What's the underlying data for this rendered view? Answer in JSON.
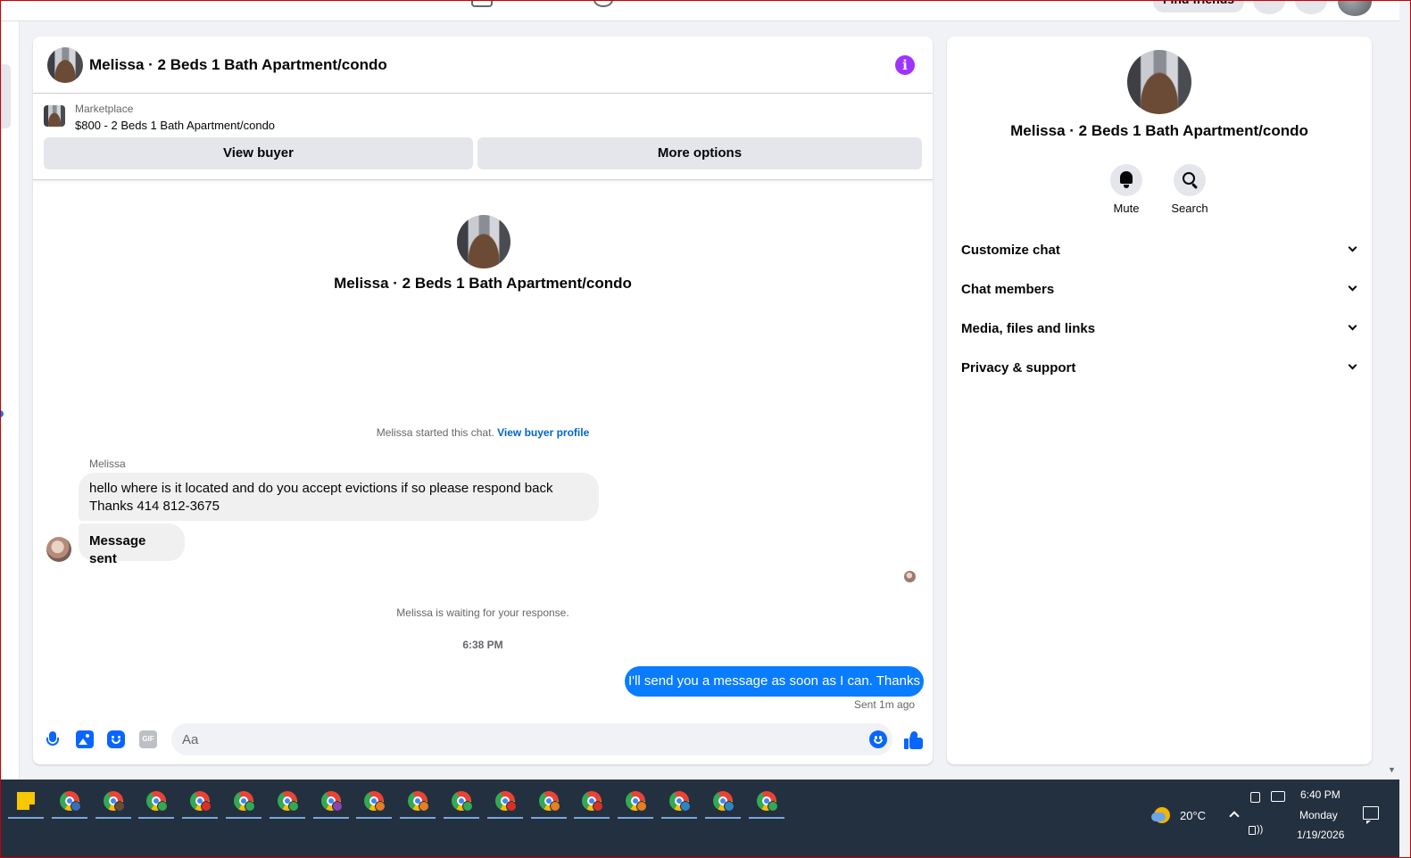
{
  "chat": {
    "title": "Melissa · 2 Beds 1 Bath Apartment/condo",
    "listing": {
      "source_label": "Marketplace",
      "price_title": "$800 - 2 Beds 1 Bath Apartment/condo",
      "view_buyer_label": "View buyer",
      "more_options_label": "More options"
    },
    "intro_title": "Melissa · 2 Beds 1 Bath Apartment/condo",
    "started_note": "Melissa started this chat.",
    "view_profile_link": "View buyer profile",
    "messages": [
      {
        "sender": "Melissa",
        "direction": "in",
        "lines": [
          "hello where is it located and do you accept evictions if so please respond back",
          "Thanks 414 812-3675"
        ]
      },
      {
        "direction": "in",
        "text": "Message sent"
      },
      {
        "direction": "out",
        "text": "I'll send you a message as soon as I can. Thanks",
        "status": "Sent 1m ago"
      }
    ],
    "waiting_note": "Melissa is waiting for your response.",
    "timestamp": "6:38 PM",
    "composer": {
      "placeholder": "Aa",
      "icons": [
        "mic-icon",
        "image-icon",
        "sticker-icon",
        "gif-icon",
        "emoji-icon",
        "like-icon"
      ],
      "gif_label": "GIF",
      "accent_color": "#0866ff"
    },
    "info_color": "#a033ff",
    "outgoing_bubble_color": "#0a7cff"
  },
  "side": {
    "title": "Melissa · 2 Beds 1 Bath Apartment/condo",
    "actions": [
      {
        "label": "Mute",
        "icon": "bell-icon"
      },
      {
        "label": "Search",
        "icon": "search-icon"
      }
    ],
    "sections": [
      {
        "label": "Customize chat"
      },
      {
        "label": "Chat members"
      },
      {
        "label": "Media, files and links"
      },
      {
        "label": "Privacy & support"
      }
    ]
  },
  "topnav": {
    "find_friends_label": "Find friends"
  },
  "taskbar": {
    "pinned": [
      {
        "icon": "sticky-notes-icon"
      },
      {
        "icon": "chrome-icon",
        "badge_color": "#3b6fb6"
      },
      {
        "icon": "chrome-icon",
        "badge_color": "#6b4b35"
      },
      {
        "icon": "chrome-icon",
        "badge_color": "#34a853"
      },
      {
        "icon": "chrome-icon",
        "badge_color": "#d93025"
      },
      {
        "icon": "chrome-icon",
        "badge_color": "#34a853"
      },
      {
        "icon": "chrome-icon",
        "badge_color": "#34a853"
      },
      {
        "icon": "chrome-icon",
        "badge_color": "#8e44ad"
      },
      {
        "icon": "chrome-icon",
        "badge_color": "#e67e22"
      },
      {
        "icon": "chrome-icon",
        "badge_color": "#e67e22"
      },
      {
        "icon": "chrome-icon",
        "badge_color": "#34a853"
      },
      {
        "icon": "chrome-icon",
        "badge_color": "#d93025"
      },
      {
        "icon": "chrome-icon",
        "badge_color": "#e67e22"
      },
      {
        "icon": "chrome-icon",
        "badge_color": "#d93025"
      },
      {
        "icon": "chrome-icon",
        "badge_color": "#e67e22"
      },
      {
        "icon": "chrome-icon",
        "badge_color": "#2e86c1"
      },
      {
        "icon": "chrome-icon",
        "badge_color": "#2e86c1"
      },
      {
        "icon": "chrome-icon",
        "badge_color": "#34a853"
      }
    ],
    "temperature": "20°C",
    "time": "6:40 PM",
    "day": "Monday",
    "date": "1/19/2026"
  }
}
